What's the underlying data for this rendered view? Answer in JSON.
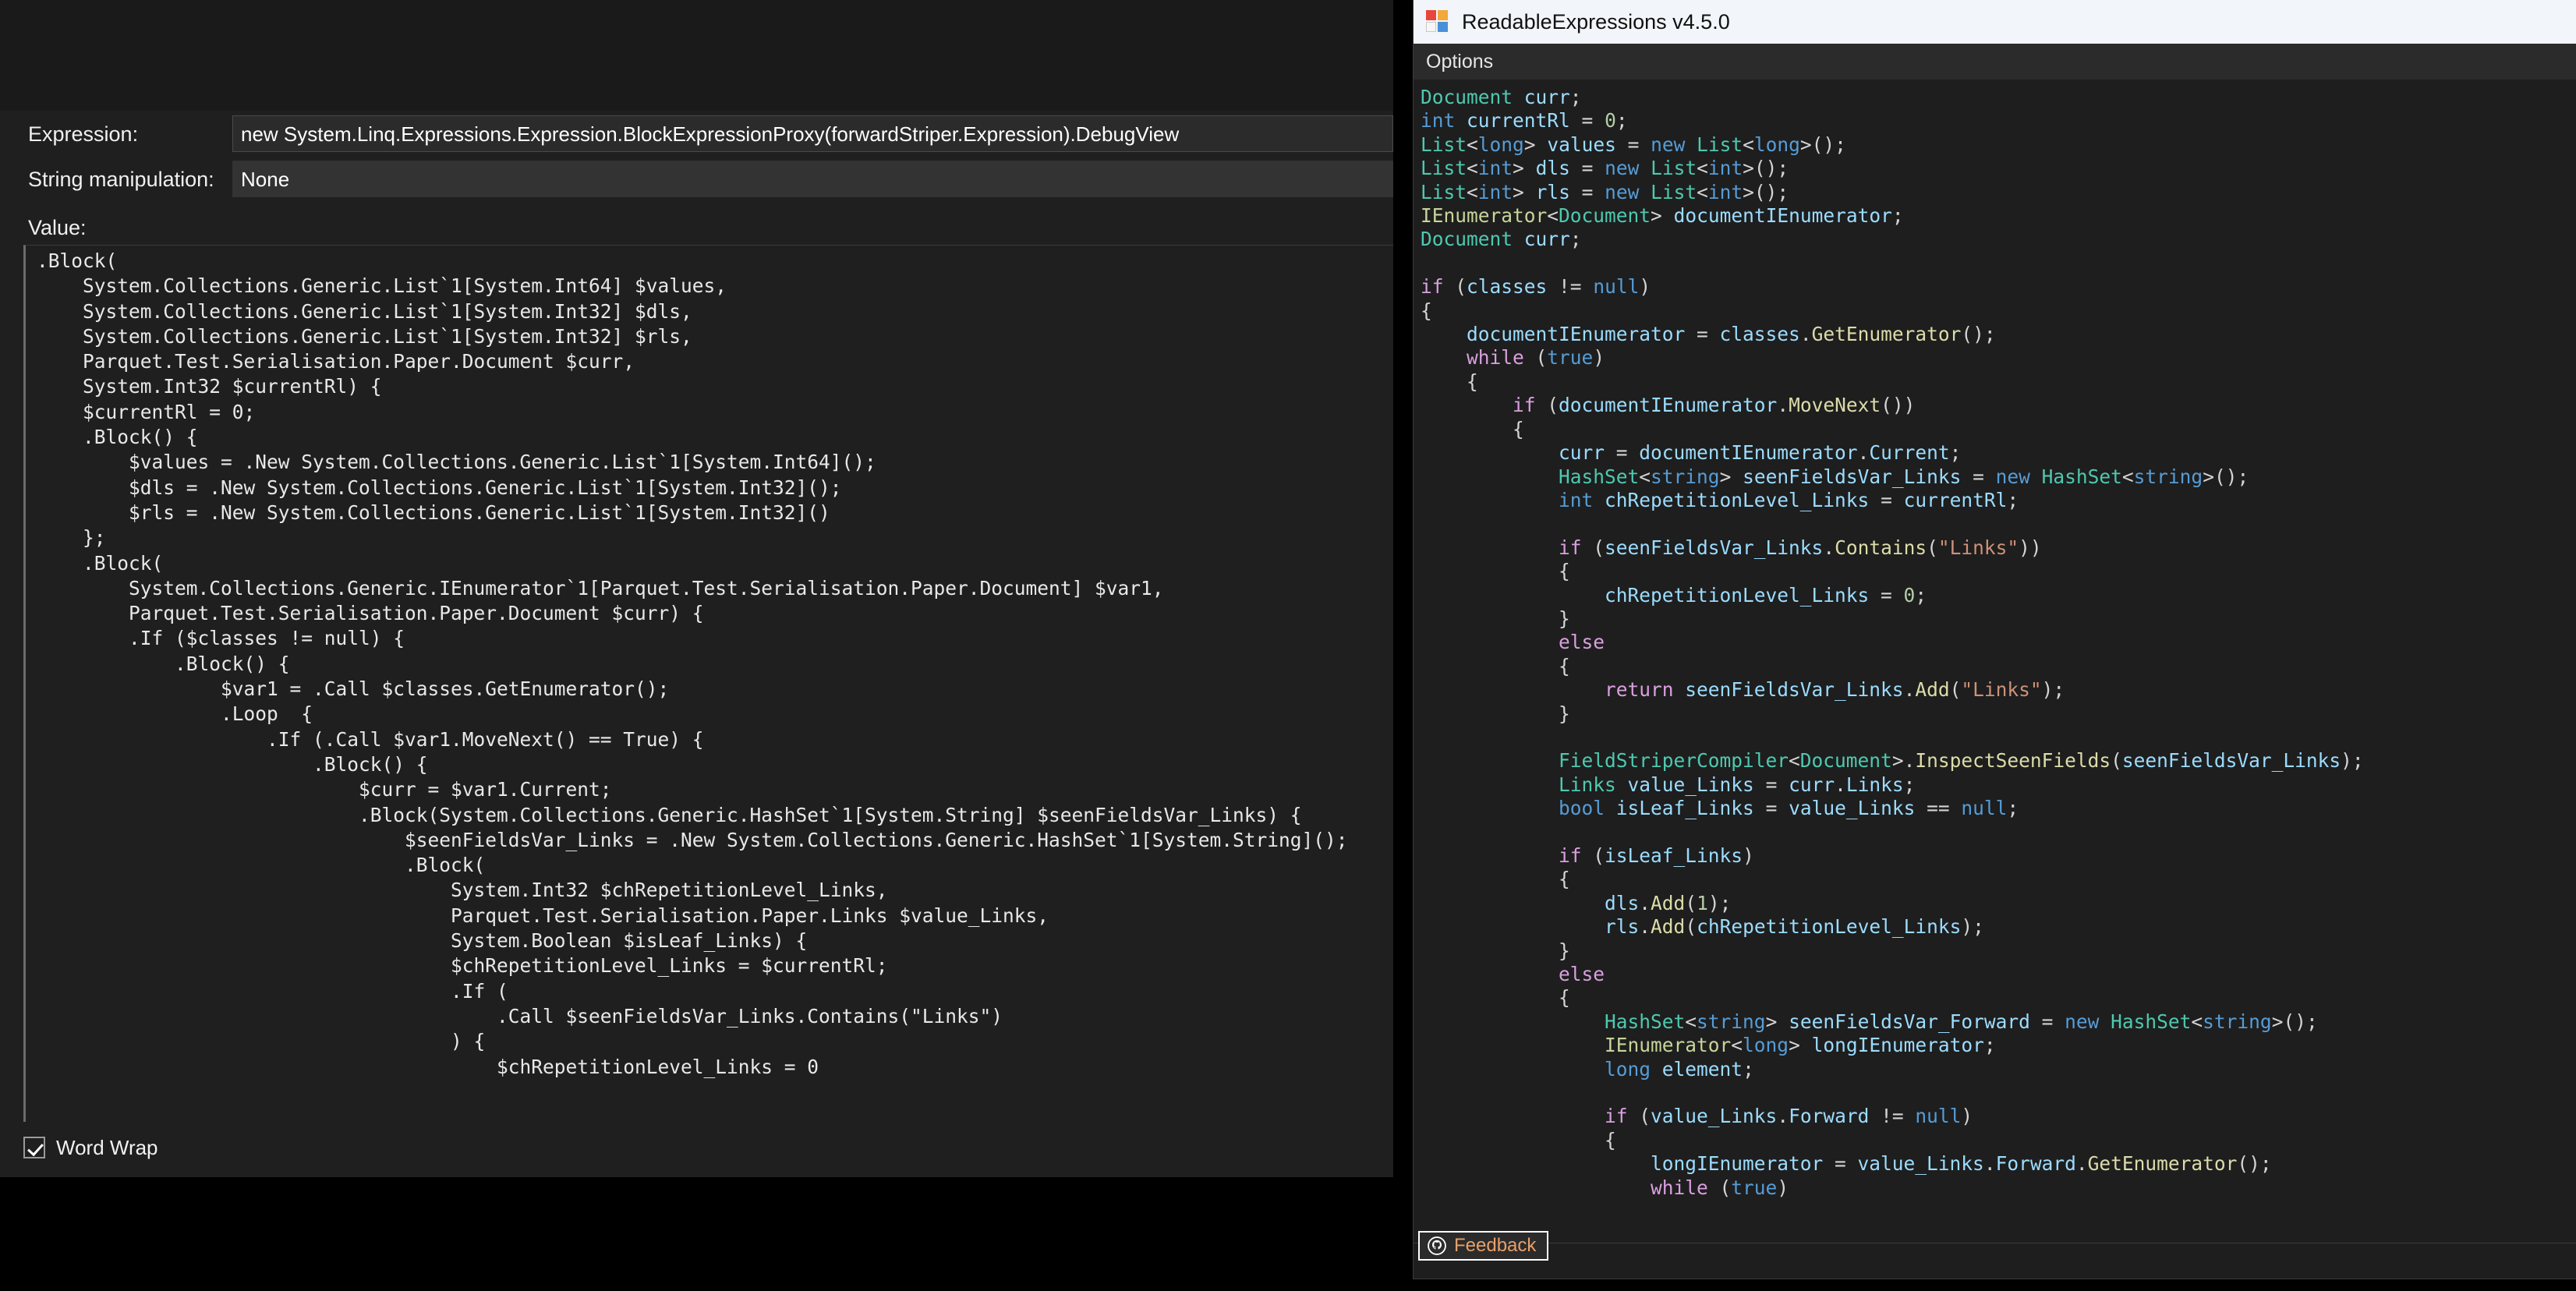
{
  "debugger_pane": {
    "expression_label": "Expression:",
    "expression_value": "new System.Linq.Expressions.Expression.BlockExpressionProxy(forwardStriper.Expression).DebugView",
    "string_manipulation_label": "String manipulation:",
    "string_manipulation_value": "None",
    "value_label": "Value:",
    "value_text": ".Block(\n    System.Collections.Generic.List`1[System.Int64] $values,\n    System.Collections.Generic.List`1[System.Int32] $dls,\n    System.Collections.Generic.List`1[System.Int32] $rls,\n    Parquet.Test.Serialisation.Paper.Document $curr,\n    System.Int32 $currentRl) {\n    $currentRl = 0;\n    .Block() {\n        $values = .New System.Collections.Generic.List`1[System.Int64]();\n        $dls = .New System.Collections.Generic.List`1[System.Int32]();\n        $rls = .New System.Collections.Generic.List`1[System.Int32]()\n    };\n    .Block(\n        System.Collections.Generic.IEnumerator`1[Parquet.Test.Serialisation.Paper.Document] $var1,\n        Parquet.Test.Serialisation.Paper.Document $curr) {\n        .If ($classes != null) {\n            .Block() {\n                $var1 = .Call $classes.GetEnumerator();\n                .Loop  {\n                    .If (.Call $var1.MoveNext() == True) {\n                        .Block() {\n                            $curr = $var1.Current;\n                            .Block(System.Collections.Generic.HashSet`1[System.String] $seenFieldsVar_Links) {\n                                $seenFieldsVar_Links = .New System.Collections.Generic.HashSet`1[System.String]();\n                                .Block(\n                                    System.Int32 $chRepetitionLevel_Links,\n                                    Parquet.Test.Serialisation.Paper.Links $value_Links,\n                                    System.Boolean $isLeaf_Links) {\n                                    $chRepetitionLevel_Links = $currentRl;\n                                    .If (\n                                        .Call $seenFieldsVar_Links.Contains(\"Links\")\n                                    ) {\n                                        $chRepetitionLevel_Links = 0",
    "word_wrap_label": "Word Wrap",
    "word_wrap_checked": true
  },
  "readable_expressions": {
    "title": "ReadableExpressions v4.5.0",
    "app_icon": "readable-expressions-logo",
    "menu": [
      {
        "label": "Options"
      }
    ],
    "feedback_button": {
      "label": "Feedback",
      "icon": "github-icon"
    },
    "colors": {
      "background": "#1e1e1e",
      "titlebar": "#f2f5f9",
      "menubar": "#2b2b2b",
      "keyword": "#d9a0df",
      "type": "#4ec9b0",
      "interface": "#c8d49a",
      "primitive": "#569cd6",
      "variable": "#9cdcfe",
      "method": "#dcdcaa",
      "string": "#ce9178",
      "number": "#b5cea8",
      "punctuation": "#d4d4d4",
      "feedback_text": "#e8a06a"
    },
    "code_lines": [
      [
        {
          "t": "type",
          "v": "Document"
        },
        {
          "t": "punc",
          "v": " "
        },
        {
          "t": "var",
          "v": "curr"
        },
        {
          "t": "punc",
          "v": ";"
        }
      ],
      [
        {
          "t": "blue",
          "v": "int"
        },
        {
          "t": "punc",
          "v": " "
        },
        {
          "t": "var",
          "v": "currentRl"
        },
        {
          "t": "punc",
          "v": " = "
        },
        {
          "t": "num",
          "v": "0"
        },
        {
          "t": "punc",
          "v": ";"
        }
      ],
      [
        {
          "t": "type",
          "v": "List"
        },
        {
          "t": "punc",
          "v": "<"
        },
        {
          "t": "blue",
          "v": "long"
        },
        {
          "t": "punc",
          "v": "> "
        },
        {
          "t": "var",
          "v": "values"
        },
        {
          "t": "punc",
          "v": " = "
        },
        {
          "t": "blue",
          "v": "new"
        },
        {
          "t": "punc",
          "v": " "
        },
        {
          "t": "type",
          "v": "List"
        },
        {
          "t": "punc",
          "v": "<"
        },
        {
          "t": "blue",
          "v": "long"
        },
        {
          "t": "punc",
          "v": ">();"
        }
      ],
      [
        {
          "t": "type",
          "v": "List"
        },
        {
          "t": "punc",
          "v": "<"
        },
        {
          "t": "blue",
          "v": "int"
        },
        {
          "t": "punc",
          "v": "> "
        },
        {
          "t": "var",
          "v": "dls"
        },
        {
          "t": "punc",
          "v": " = "
        },
        {
          "t": "blue",
          "v": "new"
        },
        {
          "t": "punc",
          "v": " "
        },
        {
          "t": "type",
          "v": "List"
        },
        {
          "t": "punc",
          "v": "<"
        },
        {
          "t": "blue",
          "v": "int"
        },
        {
          "t": "punc",
          "v": ">();"
        }
      ],
      [
        {
          "t": "type",
          "v": "List"
        },
        {
          "t": "punc",
          "v": "<"
        },
        {
          "t": "blue",
          "v": "int"
        },
        {
          "t": "punc",
          "v": "> "
        },
        {
          "t": "var",
          "v": "rls"
        },
        {
          "t": "punc",
          "v": " = "
        },
        {
          "t": "blue",
          "v": "new"
        },
        {
          "t": "punc",
          "v": " "
        },
        {
          "t": "type",
          "v": "List"
        },
        {
          "t": "punc",
          "v": "<"
        },
        {
          "t": "blue",
          "v": "int"
        },
        {
          "t": "punc",
          "v": ">();"
        }
      ],
      [
        {
          "t": "iface",
          "v": "IEnumerator"
        },
        {
          "t": "punc",
          "v": "<"
        },
        {
          "t": "type",
          "v": "Document"
        },
        {
          "t": "punc",
          "v": "> "
        },
        {
          "t": "var",
          "v": "documentIEnumerator"
        },
        {
          "t": "punc",
          "v": ";"
        }
      ],
      [
        {
          "t": "type",
          "v": "Document"
        },
        {
          "t": "punc",
          "v": " "
        },
        {
          "t": "var",
          "v": "curr"
        },
        {
          "t": "punc",
          "v": ";"
        }
      ],
      [],
      [
        {
          "t": "kw",
          "v": "if"
        },
        {
          "t": "punc",
          "v": " ("
        },
        {
          "t": "var",
          "v": "classes"
        },
        {
          "t": "punc",
          "v": " != "
        },
        {
          "t": "blue",
          "v": "null"
        },
        {
          "t": "punc",
          "v": ")"
        }
      ],
      [
        {
          "t": "punc",
          "v": "{"
        }
      ],
      [
        {
          "t": "punc",
          "v": "    "
        },
        {
          "t": "var",
          "v": "documentIEnumerator"
        },
        {
          "t": "punc",
          "v": " = "
        },
        {
          "t": "var",
          "v": "classes"
        },
        {
          "t": "punc",
          "v": "."
        },
        {
          "t": "meth",
          "v": "GetEnumerator"
        },
        {
          "t": "punc",
          "v": "();"
        }
      ],
      [
        {
          "t": "punc",
          "v": "    "
        },
        {
          "t": "kw",
          "v": "while"
        },
        {
          "t": "punc",
          "v": " ("
        },
        {
          "t": "blue",
          "v": "true"
        },
        {
          "t": "punc",
          "v": ")"
        }
      ],
      [
        {
          "t": "punc",
          "v": "    {"
        }
      ],
      [
        {
          "t": "punc",
          "v": "        "
        },
        {
          "t": "kw",
          "v": "if"
        },
        {
          "t": "punc",
          "v": " ("
        },
        {
          "t": "var",
          "v": "documentIEnumerator"
        },
        {
          "t": "punc",
          "v": "."
        },
        {
          "t": "meth",
          "v": "MoveNext"
        },
        {
          "t": "punc",
          "v": "())"
        }
      ],
      [
        {
          "t": "punc",
          "v": "        {"
        }
      ],
      [
        {
          "t": "punc",
          "v": "            "
        },
        {
          "t": "var",
          "v": "curr"
        },
        {
          "t": "punc",
          "v": " = "
        },
        {
          "t": "var",
          "v": "documentIEnumerator"
        },
        {
          "t": "punc",
          "v": "."
        },
        {
          "t": "var",
          "v": "Current"
        },
        {
          "t": "punc",
          "v": ";"
        }
      ],
      [
        {
          "t": "punc",
          "v": "            "
        },
        {
          "t": "type",
          "v": "HashSet"
        },
        {
          "t": "punc",
          "v": "<"
        },
        {
          "t": "blue",
          "v": "string"
        },
        {
          "t": "punc",
          "v": "> "
        },
        {
          "t": "var",
          "v": "seenFieldsVar_Links"
        },
        {
          "t": "punc",
          "v": " = "
        },
        {
          "t": "blue",
          "v": "new"
        },
        {
          "t": "punc",
          "v": " "
        },
        {
          "t": "type",
          "v": "HashSet"
        },
        {
          "t": "punc",
          "v": "<"
        },
        {
          "t": "blue",
          "v": "string"
        },
        {
          "t": "punc",
          "v": ">();"
        }
      ],
      [
        {
          "t": "punc",
          "v": "            "
        },
        {
          "t": "blue",
          "v": "int"
        },
        {
          "t": "punc",
          "v": " "
        },
        {
          "t": "var",
          "v": "chRepetitionLevel_Links"
        },
        {
          "t": "punc",
          "v": " = "
        },
        {
          "t": "var",
          "v": "currentRl"
        },
        {
          "t": "punc",
          "v": ";"
        }
      ],
      [],
      [
        {
          "t": "punc",
          "v": "            "
        },
        {
          "t": "kw",
          "v": "if"
        },
        {
          "t": "punc",
          "v": " ("
        },
        {
          "t": "var",
          "v": "seenFieldsVar_Links"
        },
        {
          "t": "punc",
          "v": "."
        },
        {
          "t": "meth",
          "v": "Contains"
        },
        {
          "t": "punc",
          "v": "("
        },
        {
          "t": "str",
          "v": "\"Links\""
        },
        {
          "t": "punc",
          "v": "))"
        }
      ],
      [
        {
          "t": "punc",
          "v": "            {"
        }
      ],
      [
        {
          "t": "punc",
          "v": "                "
        },
        {
          "t": "var",
          "v": "chRepetitionLevel_Links"
        },
        {
          "t": "punc",
          "v": " = "
        },
        {
          "t": "num",
          "v": "0"
        },
        {
          "t": "punc",
          "v": ";"
        }
      ],
      [
        {
          "t": "punc",
          "v": "            }"
        }
      ],
      [
        {
          "t": "punc",
          "v": "            "
        },
        {
          "t": "kw",
          "v": "else"
        }
      ],
      [
        {
          "t": "punc",
          "v": "            {"
        }
      ],
      [
        {
          "t": "punc",
          "v": "                "
        },
        {
          "t": "kw",
          "v": "return"
        },
        {
          "t": "punc",
          "v": " "
        },
        {
          "t": "var",
          "v": "seenFieldsVar_Links"
        },
        {
          "t": "punc",
          "v": "."
        },
        {
          "t": "meth",
          "v": "Add"
        },
        {
          "t": "punc",
          "v": "("
        },
        {
          "t": "str",
          "v": "\"Links\""
        },
        {
          "t": "punc",
          "v": ");"
        }
      ],
      [
        {
          "t": "punc",
          "v": "            }"
        }
      ],
      [],
      [
        {
          "t": "punc",
          "v": "            "
        },
        {
          "t": "type",
          "v": "FieldStriperCompiler"
        },
        {
          "t": "punc",
          "v": "<"
        },
        {
          "t": "type",
          "v": "Document"
        },
        {
          "t": "punc",
          "v": ">."
        },
        {
          "t": "meth",
          "v": "InspectSeenFields"
        },
        {
          "t": "punc",
          "v": "("
        },
        {
          "t": "var",
          "v": "seenFieldsVar_Links"
        },
        {
          "t": "punc",
          "v": ");"
        }
      ],
      [
        {
          "t": "punc",
          "v": "            "
        },
        {
          "t": "type",
          "v": "Links"
        },
        {
          "t": "punc",
          "v": " "
        },
        {
          "t": "var",
          "v": "value_Links"
        },
        {
          "t": "punc",
          "v": " = "
        },
        {
          "t": "var",
          "v": "curr"
        },
        {
          "t": "punc",
          "v": "."
        },
        {
          "t": "var",
          "v": "Links"
        },
        {
          "t": "punc",
          "v": ";"
        }
      ],
      [
        {
          "t": "punc",
          "v": "            "
        },
        {
          "t": "blue",
          "v": "bool"
        },
        {
          "t": "punc",
          "v": " "
        },
        {
          "t": "var",
          "v": "isLeaf_Links"
        },
        {
          "t": "punc",
          "v": " = "
        },
        {
          "t": "var",
          "v": "value_Links"
        },
        {
          "t": "punc",
          "v": " == "
        },
        {
          "t": "blue",
          "v": "null"
        },
        {
          "t": "punc",
          "v": ";"
        }
      ],
      [],
      [
        {
          "t": "punc",
          "v": "            "
        },
        {
          "t": "kw",
          "v": "if"
        },
        {
          "t": "punc",
          "v": " ("
        },
        {
          "t": "var",
          "v": "isLeaf_Links"
        },
        {
          "t": "punc",
          "v": ")"
        }
      ],
      [
        {
          "t": "punc",
          "v": "            {"
        }
      ],
      [
        {
          "t": "punc",
          "v": "                "
        },
        {
          "t": "var",
          "v": "dls"
        },
        {
          "t": "punc",
          "v": "."
        },
        {
          "t": "meth",
          "v": "Add"
        },
        {
          "t": "punc",
          "v": "("
        },
        {
          "t": "num",
          "v": "1"
        },
        {
          "t": "punc",
          "v": ");"
        }
      ],
      [
        {
          "t": "punc",
          "v": "                "
        },
        {
          "t": "var",
          "v": "rls"
        },
        {
          "t": "punc",
          "v": "."
        },
        {
          "t": "meth",
          "v": "Add"
        },
        {
          "t": "punc",
          "v": "("
        },
        {
          "t": "var",
          "v": "chRepetitionLevel_Links"
        },
        {
          "t": "punc",
          "v": ");"
        }
      ],
      [
        {
          "t": "punc",
          "v": "            }"
        }
      ],
      [
        {
          "t": "punc",
          "v": "            "
        },
        {
          "t": "kw",
          "v": "else"
        }
      ],
      [
        {
          "t": "punc",
          "v": "            {"
        }
      ],
      [
        {
          "t": "punc",
          "v": "                "
        },
        {
          "t": "type",
          "v": "HashSet"
        },
        {
          "t": "punc",
          "v": "<"
        },
        {
          "t": "blue",
          "v": "string"
        },
        {
          "t": "punc",
          "v": "> "
        },
        {
          "t": "var",
          "v": "seenFieldsVar_Forward"
        },
        {
          "t": "punc",
          "v": " = "
        },
        {
          "t": "blue",
          "v": "new"
        },
        {
          "t": "punc",
          "v": " "
        },
        {
          "t": "type",
          "v": "HashSet"
        },
        {
          "t": "punc",
          "v": "<"
        },
        {
          "t": "blue",
          "v": "string"
        },
        {
          "t": "punc",
          "v": ">();"
        }
      ],
      [
        {
          "t": "punc",
          "v": "                "
        },
        {
          "t": "iface",
          "v": "IEnumerator"
        },
        {
          "t": "punc",
          "v": "<"
        },
        {
          "t": "blue",
          "v": "long"
        },
        {
          "t": "punc",
          "v": "> "
        },
        {
          "t": "var",
          "v": "longIEnumerator"
        },
        {
          "t": "punc",
          "v": ";"
        }
      ],
      [
        {
          "t": "punc",
          "v": "                "
        },
        {
          "t": "blue",
          "v": "long"
        },
        {
          "t": "punc",
          "v": " "
        },
        {
          "t": "var",
          "v": "element"
        },
        {
          "t": "punc",
          "v": ";"
        }
      ],
      [],
      [
        {
          "t": "punc",
          "v": "                "
        },
        {
          "t": "kw",
          "v": "if"
        },
        {
          "t": "punc",
          "v": " ("
        },
        {
          "t": "var",
          "v": "value_Links"
        },
        {
          "t": "punc",
          "v": "."
        },
        {
          "t": "var",
          "v": "Forward"
        },
        {
          "t": "punc",
          "v": " != "
        },
        {
          "t": "blue",
          "v": "null"
        },
        {
          "t": "punc",
          "v": ")"
        }
      ],
      [
        {
          "t": "punc",
          "v": "                {"
        }
      ],
      [
        {
          "t": "punc",
          "v": "                    "
        },
        {
          "t": "var",
          "v": "longIEnumerator"
        },
        {
          "t": "punc",
          "v": " = "
        },
        {
          "t": "var",
          "v": "value_Links"
        },
        {
          "t": "punc",
          "v": "."
        },
        {
          "t": "var",
          "v": "Forward"
        },
        {
          "t": "punc",
          "v": "."
        },
        {
          "t": "meth",
          "v": "GetEnumerator"
        },
        {
          "t": "punc",
          "v": "();"
        }
      ],
      [
        {
          "t": "punc",
          "v": "                    "
        },
        {
          "t": "kw",
          "v": "while"
        },
        {
          "t": "punc",
          "v": " ("
        },
        {
          "t": "blue",
          "v": "true"
        },
        {
          "t": "punc",
          "v": ")"
        }
      ]
    ]
  }
}
